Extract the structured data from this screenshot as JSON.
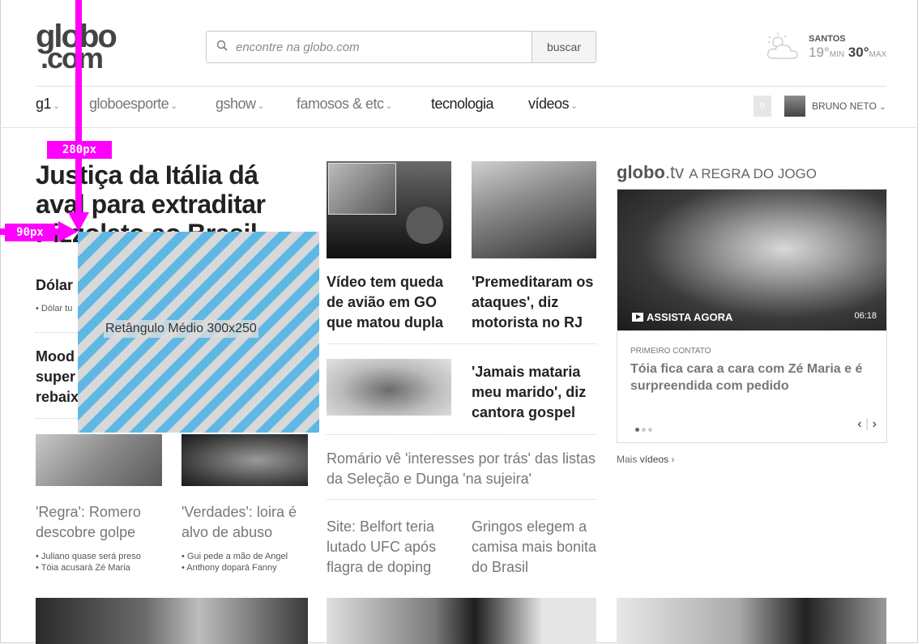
{
  "header": {
    "logo_line1": "globo",
    "logo_line2": ".com",
    "search_placeholder": "encontre na globo.com",
    "search_button": "buscar",
    "weather": {
      "city": "SANTOS",
      "min": "19°",
      "min_label": "MIN",
      "max": "30°",
      "max_label": "MAX"
    }
  },
  "nav": {
    "items": [
      "g1",
      "globoesporte",
      "gshow",
      "famosos & etc",
      "tecnologia",
      "vídeos"
    ],
    "notification_count": "0",
    "user_name": "BRUNO NETO"
  },
  "annotations": {
    "top_label": "280px",
    "left_label": "90px",
    "accent": "#ff00ff"
  },
  "ad": {
    "label": "Retângulo Médio 300x250",
    "stripe_color": "#5fb8e4"
  },
  "main": {
    "headline": "Justiça da Itália dá aval para extraditar Pizzolato ao Brasil",
    "story_dolar": "Dólar",
    "story_dolar_sub": "• Dólar tu",
    "story_moodys": "Mood super rebaix",
    "story_regra": "'Regra': Romero descobre golpe",
    "story_regra_subs": [
      "• Juliano quase será preso",
      "• Tóia acusará Zé Maria"
    ],
    "story_verdades": "'Verdades': loira é alvo de abuso",
    "story_verdades_subs": [
      "• Gui pede a mão de Angel",
      "• Anthony dopará Fanny"
    ]
  },
  "center": {
    "story_aviao": "Vídeo tem queda de avião em GO que matou dupla",
    "story_premeditaram": "'Premeditaram os ataques', diz motorista no RJ",
    "story_jamais": "'Jamais mataria meu marido', diz cantora gospel",
    "story_romario": "Romário vê 'interesses por trás' das listas da Seleção e Dunga 'na sujeira'",
    "story_belfort": "Site: Belfort teria lutado UFC após flagra de doping",
    "story_gringos": "Gringos elegem a camisa mais bonita do Brasil"
  },
  "globotv": {
    "brand": "globo",
    "brand_suffix": ".tv",
    "program": "A REGRA DO JOGO",
    "play_label": "ASSISTA AGORA",
    "duration": "06:18",
    "category": "PRIMEIRO CONTATO",
    "title": "Tóia fica cara a cara com Zé Maria e é surpreendida com pedido",
    "more_prefix": "Mais",
    "more_link": "vídeos",
    "more_suffix": "›"
  }
}
